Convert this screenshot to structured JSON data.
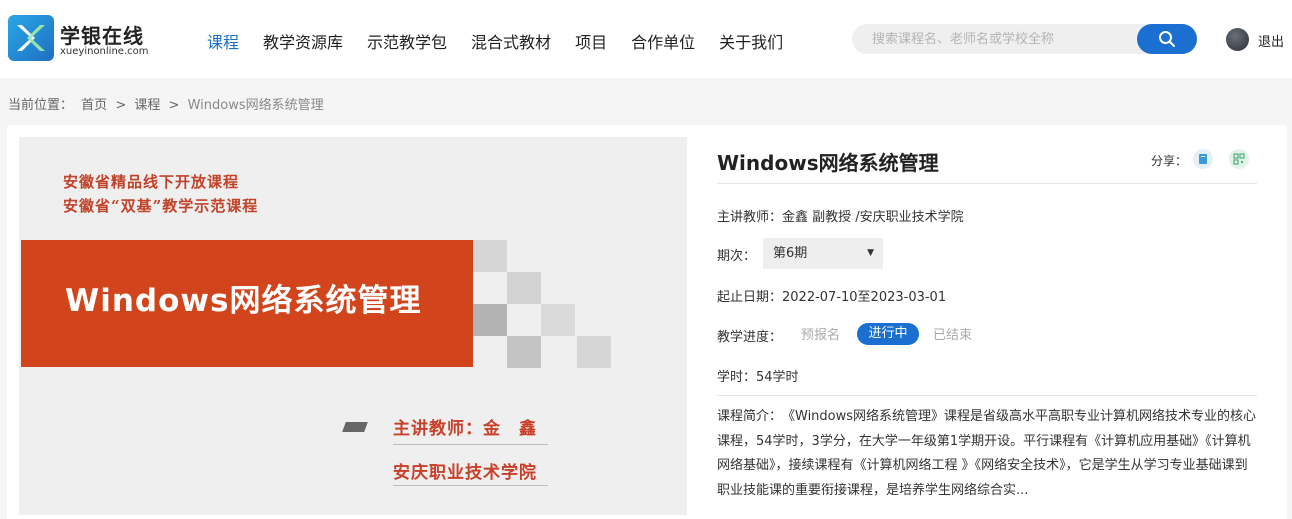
{
  "header": {
    "logo_cn": "学银在线",
    "logo_en": "xueyinonline.com",
    "nav": [
      "课程",
      "教学资源库",
      "示范教学包",
      "混合式教材",
      "项目",
      "合作单位",
      "关于我们"
    ],
    "search_placeholder": "搜索课程名、老师名或学校全称",
    "logout": "退出"
  },
  "breadcrumb": {
    "label": "当前位置：",
    "items": [
      "首页",
      ">",
      "课程",
      ">",
      "Windows网络系统管理"
    ]
  },
  "cover": {
    "tag1": "安徽省精品线下开放课程",
    "tag2": "安徽省“双基”教学示范课程",
    "banner_title": "Windows网络系统管理",
    "teacher": "主讲教师：金　鑫",
    "school": "安庆职业技术学院"
  },
  "course": {
    "title": "Windows网络系统管理",
    "share_label": "分享：",
    "teacher_line": "主讲教师：金鑫 副教授 /安庆职业技术学院",
    "period_label": "期次：",
    "period_value": "第6期",
    "date_line": "起止日期：2022-07-10至2023-03-01",
    "progress_label": "教学进度：",
    "progress_states": [
      "预报名",
      "进行中",
      "已结束"
    ],
    "hours_line": "学时：54学时",
    "intro": "课程简介：　《Windows网络系统管理》课程是省级高水平高职专业计算机网络技术专业的核心课程，54学时，3学分，在大学一年级第1学期开设。平行课程有《计算机应用基础》《计算机网络基础》，接续课程有《计算机网络工程 》《网络安全技术》，它是学生从学习专业基础课到职业技能课的重要衔接课程，是培养学生网络综合实..."
  },
  "colors": {
    "accent": "#1a6fd0",
    "banner": "#d2451c",
    "cover_text": "#c0432a"
  }
}
